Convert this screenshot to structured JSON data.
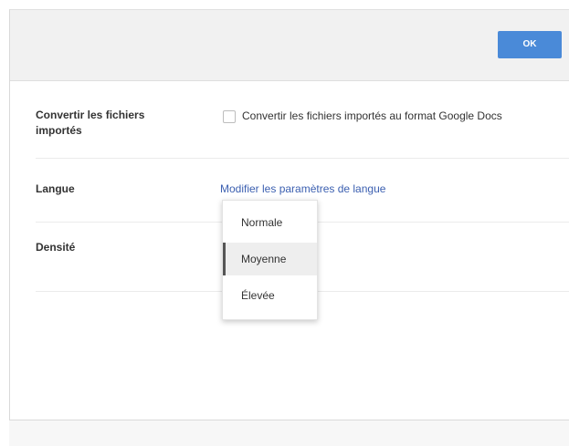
{
  "header": {
    "ok_label": "OK"
  },
  "settings": {
    "convert": {
      "label": "Convertir les fichiers importés",
      "checkbox_label": "Convertir les fichiers importés au format Google Docs",
      "checked": false
    },
    "language": {
      "label": "Langue",
      "link": "Modifier les paramètres de langue"
    },
    "density": {
      "label": "Densité",
      "options": [
        "Normale",
        "Moyenne",
        "Élevée"
      ],
      "selected": "Moyenne"
    }
  },
  "colors": {
    "accent": "#4a8ad8",
    "link": "#3b5fb0"
  }
}
